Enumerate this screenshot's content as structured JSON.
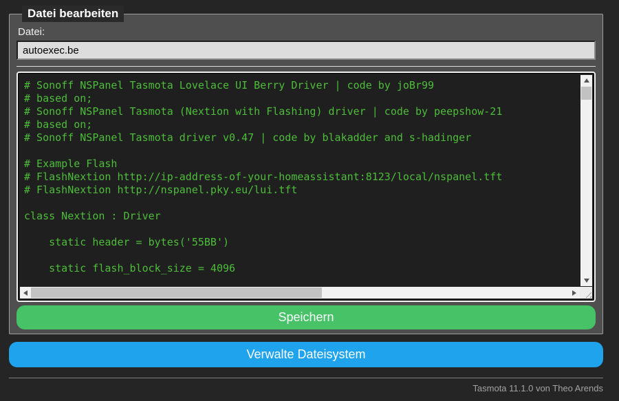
{
  "editor": {
    "legend": "Datei bearbeiten",
    "file_label": "Datei:",
    "filename": "autoexec.be",
    "code_lines": [
      "# Sonoff NSPanel Tasmota Lovelace UI Berry Driver | code by joBr99",
      "# based on;",
      "# Sonoff NSPanel Tasmota (Nextion with Flashing) driver | code by peepshow-21",
      "# based on;",
      "# Sonoff NSPanel Tasmota driver v0.47 | code by blakadder and s-hadinger",
      "",
      "# Example Flash",
      "# FlashNextion http://ip-address-of-your-homeassistant:8123/local/nspanel.tft",
      "# FlashNextion http://nspanel.pky.eu/lui.tft",
      "",
      "class Nextion : Driver",
      "",
      "    static header = bytes('55BB')",
      "",
      "    static flash_block_size = 4096"
    ],
    "save_button_label": "Speichern"
  },
  "actions": {
    "manage_filesystem_label": "Verwalte Dateisystem"
  },
  "footer": {
    "version_text": "Tasmota 11.1.0 von Theo Arends"
  },
  "icons": {
    "scroll_up": "triangle-up",
    "scroll_down": "triangle-down",
    "scroll_left": "triangle-left",
    "scroll_right": "triangle-right",
    "resize_grip": "diagonal-lines"
  },
  "colors": {
    "page_bg": "#252525",
    "panel_bg": "#4f4f4f",
    "panel_border": "#9e9e9e",
    "code_bg": "#1f1f1f",
    "code_text": "#4dbd3a",
    "input_bg": "#dddddd",
    "save_button_bg": "#47c266",
    "manage_button_bg": "#1fa3ec",
    "button_text": "#faffff",
    "footer_text": "#a3a3a3"
  }
}
